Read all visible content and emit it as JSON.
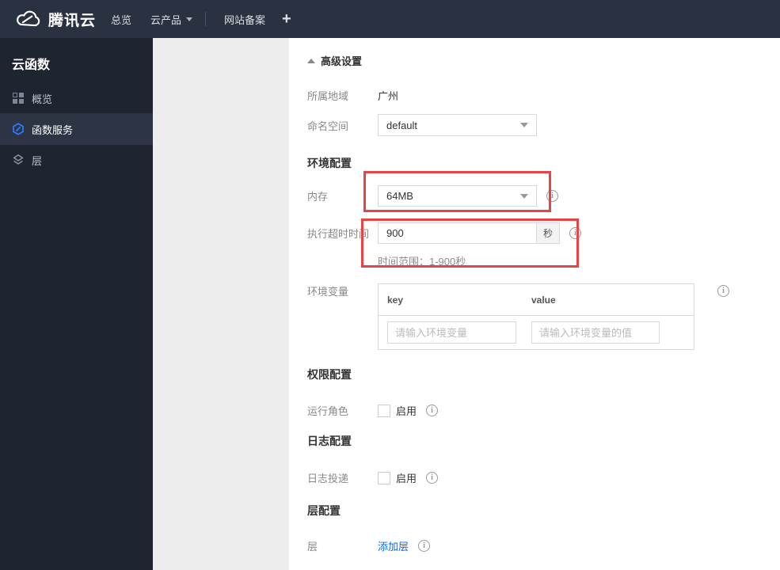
{
  "colors": {
    "accent_red": "#e54545",
    "link_blue": "#006eff",
    "topbar_bg": "#2a3140",
    "sidebar_bg": "#1f2530",
    "sidebar_active_bg": "#2d3545"
  },
  "topbar": {
    "brand": "腾讯云",
    "overview": "总览",
    "products": "云产品",
    "icp": "网站备案",
    "plus": "+"
  },
  "sidebar": {
    "title": "云函数",
    "items": [
      {
        "label": "概览",
        "icon": "grid-icon",
        "active": false
      },
      {
        "label": "函数服务",
        "icon": "hexagon-function-icon",
        "active": true
      },
      {
        "label": "层",
        "icon": "layers-icon",
        "active": false
      }
    ]
  },
  "content": {
    "advanced_toggle": "高级设置",
    "region": {
      "label": "所属地域",
      "value": "广州"
    },
    "namespace": {
      "label": "命名空间",
      "value": "default"
    },
    "env_heading": "环境配置",
    "memory": {
      "label": "内存",
      "value": "64MB"
    },
    "timeout": {
      "label": "执行超时时间",
      "value": "900",
      "unit": "秒",
      "hint": "时间范围：1-900秒"
    },
    "env_vars": {
      "label": "环境变量",
      "key_header": "key",
      "value_header": "value",
      "key_placeholder": "请输入环境变量",
      "value_placeholder": "请输入环境变量的值"
    },
    "perm_heading": "权限配置",
    "role": {
      "label": "运行角色",
      "enable": "启用"
    },
    "log_heading": "日志配置",
    "log": {
      "label": "日志投递",
      "enable": "启用"
    },
    "layer_heading": "层配置",
    "layer": {
      "label": "层",
      "add_link": "添加层"
    }
  }
}
